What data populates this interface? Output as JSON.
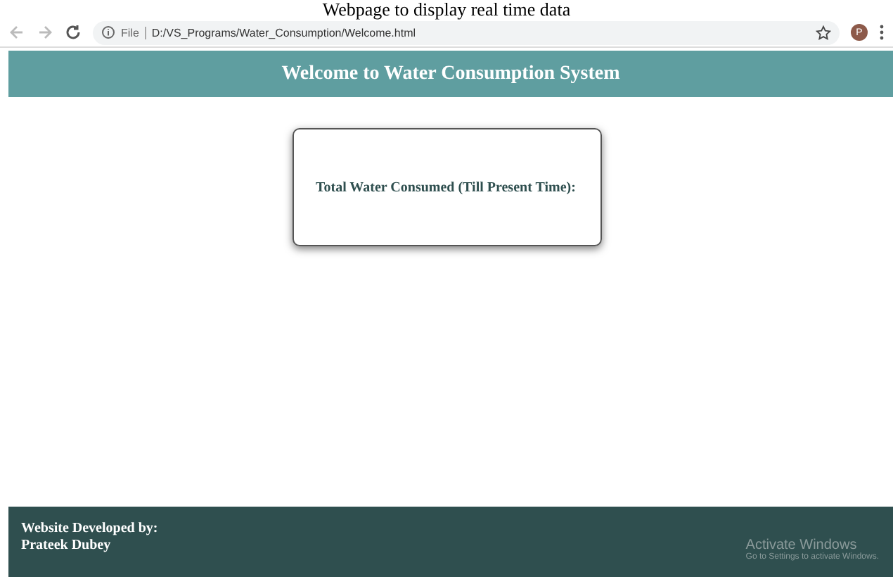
{
  "caption": "Webpage to display real time data",
  "browser": {
    "scheme": "File",
    "url": "D:/VS_Programs/Water_Consumption/Welcome.html",
    "profile": "P"
  },
  "header": {
    "title": "Welcome to Water Consumption System"
  },
  "card": {
    "label": "Total Water Consumed (Till Present Time):"
  },
  "footer": {
    "heading": "Website Developed by:",
    "author": "Prateek Dubey"
  },
  "os_notice": {
    "title": "Activate Windows",
    "subtitle": "Go to Settings to activate Windows."
  }
}
